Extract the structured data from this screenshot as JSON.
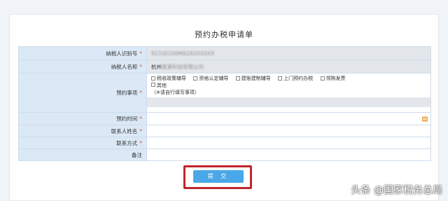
{
  "form": {
    "title": "预约办税申请单",
    "rows": {
      "taxpayer_id": {
        "label": "纳税人识别号",
        "required_mark": "*",
        "value": "91330100MA2AXXXXXX"
      },
      "taxpayer_name": {
        "label": "纳税人名称",
        "required_mark": "*",
        "value_prefix": "杭州",
        "value_blurred": "某某科技有限公司"
      },
      "appointment_items": {
        "label": "预约事项",
        "required_mark": "*",
        "options": [
          "税收政策辅导",
          "资格认定辅导",
          "建账建制辅导",
          "上门预约办税",
          "领购发票"
        ],
        "other_label": "其他",
        "other_note": "（※请自行填写事项）"
      },
      "appointment_time": {
        "label": "预约时间",
        "required_mark": "*",
        "calendar_icon": "calendar-icon"
      },
      "contact_name": {
        "label": "联系人姓名",
        "required_mark": "*"
      },
      "contact_method": {
        "label": "联系方式",
        "required_mark": "*"
      },
      "remarks": {
        "label": "备注"
      }
    },
    "submit_label": "提 交"
  },
  "watermark": "头条 @国家税务总局",
  "colors": {
    "label_bg": "#dbe8f5",
    "button": "#4aa8e8",
    "highlight_frame": "#c0262d",
    "required": "#d9534f",
    "calendar": "#e8a33c"
  }
}
